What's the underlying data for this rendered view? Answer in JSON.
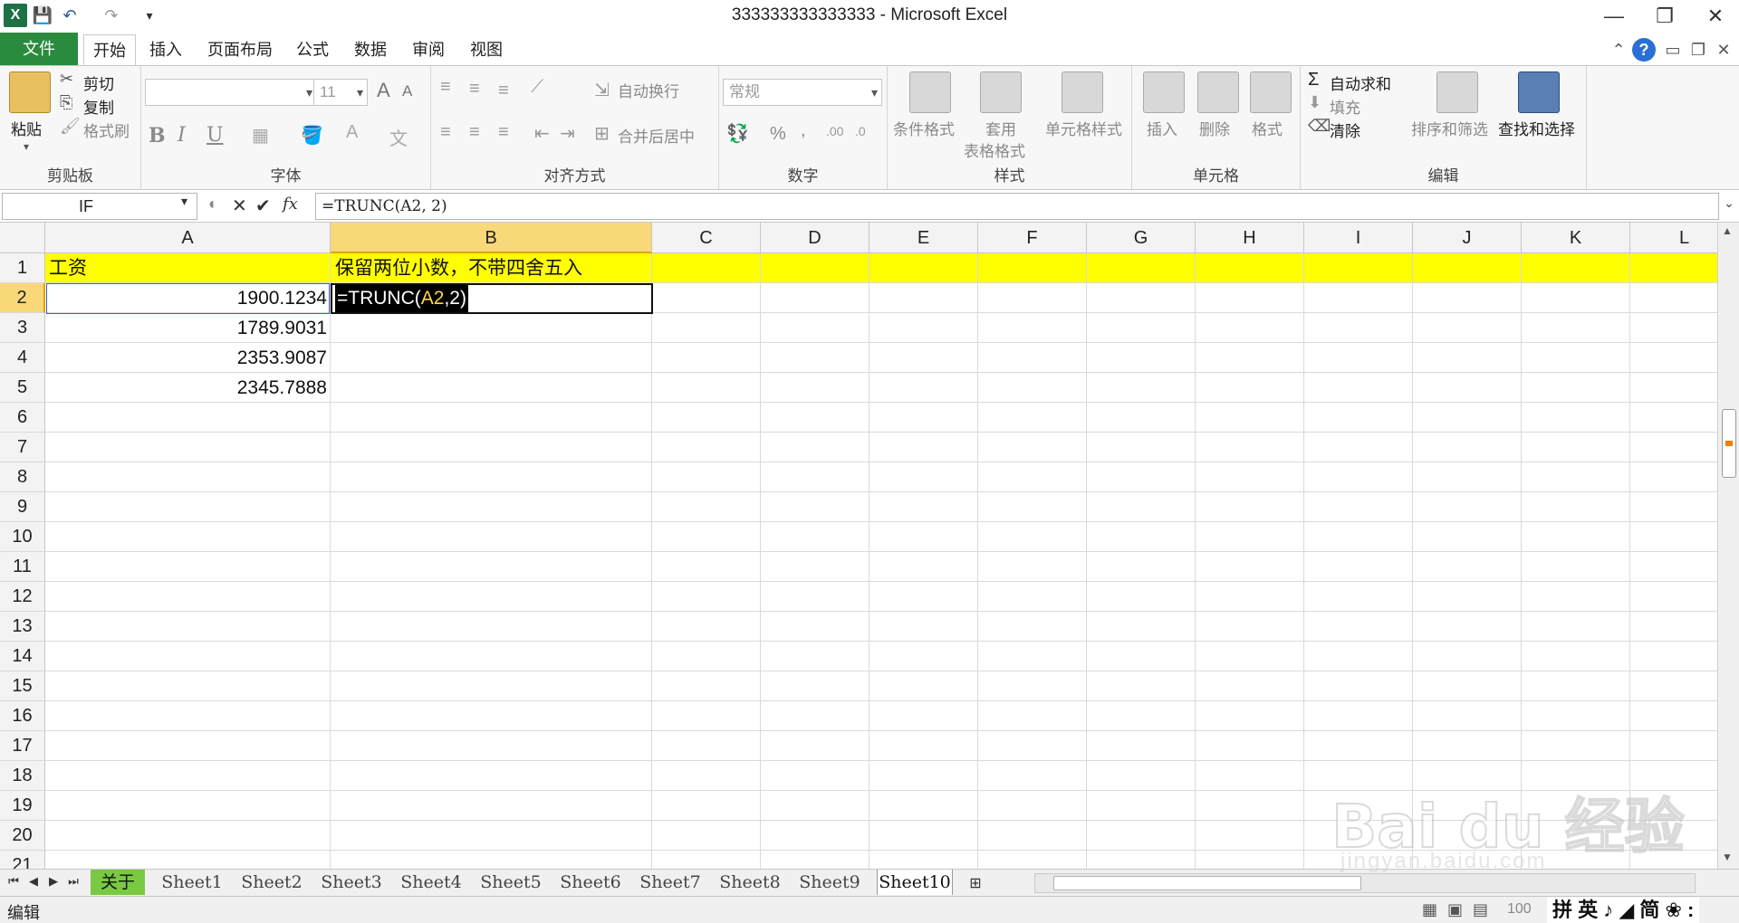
{
  "window": {
    "title": "333333333333333 - Microsoft Excel"
  },
  "quick_access": {
    "icons": [
      "excel-icon",
      "save-icon",
      "undo-icon",
      "redo-icon",
      "customize-icon"
    ]
  },
  "ribbon_tabs": [
    "文件",
    "开始",
    "插入",
    "页面布局",
    "公式",
    "数据",
    "审阅",
    "视图"
  ],
  "active_tab": "开始",
  "ribbon": {
    "clipboard": {
      "label": "剪贴板",
      "paste": "粘贴",
      "cut": "剪切",
      "copy": "复制",
      "format_painter": "格式刷"
    },
    "font": {
      "label": "字体",
      "font_name": "",
      "font_size": "11",
      "bold": "B",
      "italic": "I",
      "underline": "U"
    },
    "alignment": {
      "label": "对齐方式",
      "wrap_text": "自动换行",
      "merge_center": "合并后居中"
    },
    "number": {
      "label": "数字",
      "format": "常规",
      "percent": "%",
      "comma": ","
    },
    "styles": {
      "label": "样式",
      "conditional": "条件格式",
      "table_format_1": "套用",
      "table_format_2": "表格格式",
      "cell_styles": "单元格样式"
    },
    "cells": {
      "label": "单元格",
      "insert": "插入",
      "delete": "删除",
      "format": "格式"
    },
    "editing": {
      "label": "编辑",
      "autosum": "自动求和",
      "fill": "填充",
      "clear": "清除",
      "sort_filter": "排序和筛选",
      "find_select": "查找和选择"
    }
  },
  "formula_bar": {
    "name_box": "IF",
    "fx": "fx",
    "formula": "=TRUNC(A2, 2)"
  },
  "grid": {
    "columns": [
      "A",
      "B",
      "C",
      "D",
      "E",
      "F",
      "G",
      "H",
      "I",
      "J",
      "K",
      "L"
    ],
    "rows": [
      "1",
      "2",
      "3",
      "4",
      "5",
      "6",
      "7",
      "8",
      "9",
      "10",
      "11",
      "12",
      "13",
      "14",
      "15",
      "16",
      "17",
      "18",
      "19",
      "20",
      "21"
    ],
    "active_column": "B",
    "active_row": "2",
    "cells": {
      "A1": "工资",
      "B1": "保留两位小数，不带四舍五入",
      "A2": "1900.1234",
      "A3": "1789.9031",
      "A4": "2353.9087",
      "A5": "2345.7888"
    },
    "editing": {
      "prefix": "=TRUNC(",
      "ref": "A2",
      "suffix": ",2)"
    },
    "header_fill": "#ffff00"
  },
  "sheet_tabs": [
    "关于",
    "Sheet1",
    "Sheet2",
    "Sheet3",
    "Sheet4",
    "Sheet5",
    "Sheet6",
    "Sheet7",
    "Sheet8",
    "Sheet9",
    "Sheet10"
  ],
  "active_sheet": "Sheet10",
  "status_bar": {
    "mode": "编辑",
    "zoom": "100",
    "ime": "拼 英 ♪ ◢ 简 ❀ :"
  },
  "watermark": {
    "logo": "Bai du 经验",
    "url": "jingyan.baidu.com"
  }
}
